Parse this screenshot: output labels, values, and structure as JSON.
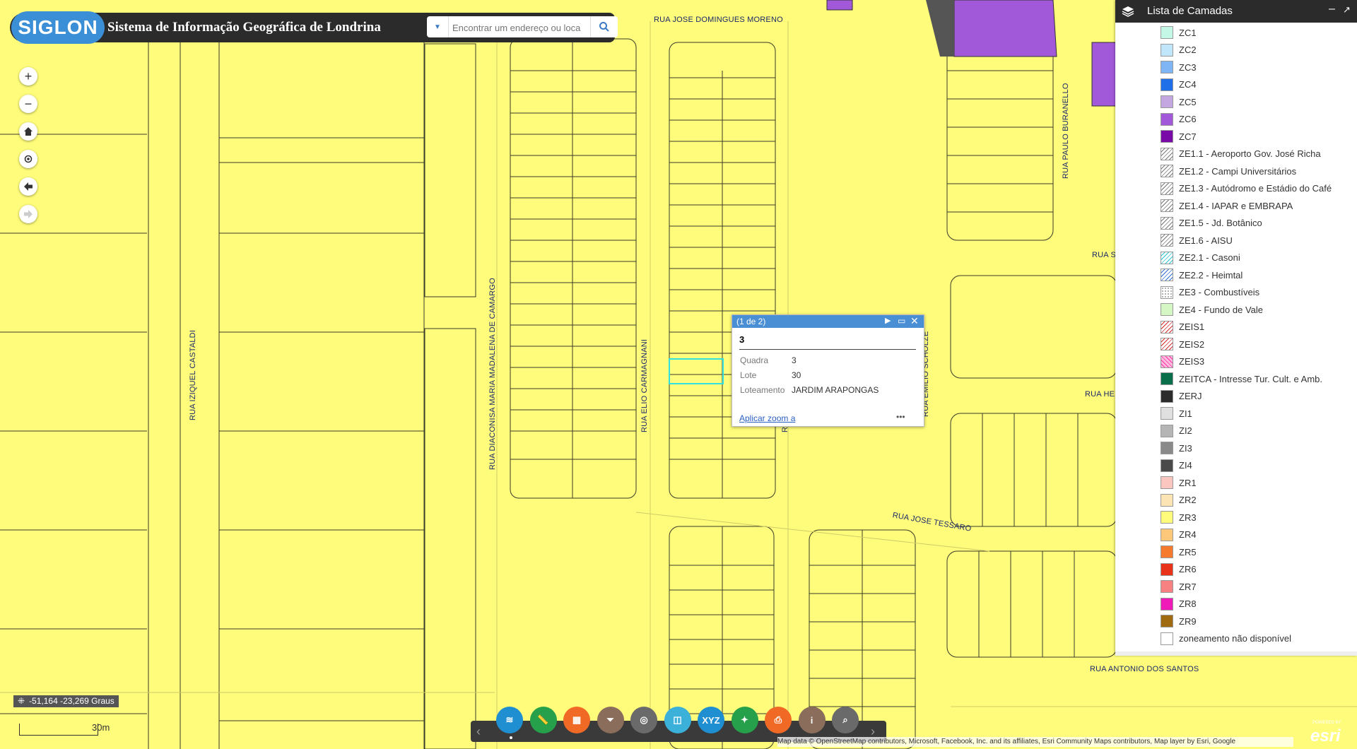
{
  "header": {
    "logo_text": "SIGLON",
    "title": "Sistema de Informação Geográfica de Londrina",
    "search_placeholder": "Encontrar um endereço ou loca"
  },
  "map_controls": {
    "zoom_in": "+",
    "zoom_out": "−"
  },
  "streets": {
    "s1": "RUA JOSE DOMINGUES MORENO",
    "s2": "RUA IZIQUEL CASTALDI",
    "s3": "RUA DIACONISA MARIA MADALENA DE CAMARGO",
    "s4": "RUA ELIO CARMAGNANI",
    "s5": "RUA EMILIO SCHOLZE",
    "s6": "RUA PAULO BURANELLO",
    "s7": "RUA JOSE TESSARO",
    "s8": "RUA ANTONIO DOS SANTOS",
    "s9": "RUA S",
    "s10": "RUA HE",
    "s11": "RU"
  },
  "layer_panel": {
    "title": "Lista de Camadas",
    "items": [
      {
        "label": "ZC1",
        "color": "#c5f7e6"
      },
      {
        "label": "ZC2",
        "color": "#bfe6fb"
      },
      {
        "label": "ZC3",
        "color": "#7fb5f5"
      },
      {
        "label": "ZC4",
        "color": "#1e6fe8"
      },
      {
        "label": "ZC5",
        "color": "#c4a6e0"
      },
      {
        "label": "ZC6",
        "color": "#a259d9"
      },
      {
        "label": "ZC7",
        "color": "#7a0aa8"
      },
      {
        "label": "ZE1.1 - Aeroporto Gov. José Richa",
        "color": "hatch-gray"
      },
      {
        "label": "ZE1.2 - Campi Universitários",
        "color": "hatch-gray"
      },
      {
        "label": "ZE1.3 - Autódromo e Estádio do Café",
        "color": "hatch-gray"
      },
      {
        "label": "ZE1.4 - IAPAR e EMBRAPA",
        "color": "hatch-gray"
      },
      {
        "label": "ZE1.5 - Jd. Botânico",
        "color": "hatch-gray"
      },
      {
        "label": "ZE1.6 - AISU",
        "color": "hatch-gray"
      },
      {
        "label": "ZE2.1 - Casoni",
        "color": "hatch-cyan"
      },
      {
        "label": "ZE2.2 - Heimtal",
        "color": "hatch-blue"
      },
      {
        "label": "ZE3 - Combustíveis",
        "color": "dots"
      },
      {
        "label": "ZE4 - Fundo de Vale",
        "color": "#d4f7c4"
      },
      {
        "label": "ZEIS1",
        "color": "hatch-red"
      },
      {
        "label": "ZEIS2",
        "color": "hatch-red"
      },
      {
        "label": "ZEIS3",
        "color": "cross-red"
      },
      {
        "label": "ZEITCA - Intresse Tur. Cult. e Amb.",
        "color": "#0b6e4a"
      },
      {
        "label": "ZERJ",
        "color": "#2b2b2b"
      },
      {
        "label": "ZI1",
        "color": "#e0e0e0"
      },
      {
        "label": "ZI2",
        "color": "#b5b5b5"
      },
      {
        "label": "ZI3",
        "color": "#8a8a8a"
      },
      {
        "label": "ZI4",
        "color": "#4a4a4a"
      },
      {
        "label": "ZR1",
        "color": "#fbc6c0"
      },
      {
        "label": "ZR2",
        "color": "#fde4b4"
      },
      {
        "label": "ZR3",
        "color": "#fefc7a"
      },
      {
        "label": "ZR4",
        "color": "#fdc87a"
      },
      {
        "label": "ZR5",
        "color": "#f67a2e"
      },
      {
        "label": "ZR6",
        "color": "#e8331a"
      },
      {
        "label": "ZR7",
        "color": "#f78080"
      },
      {
        "label": "ZR8",
        "color": "#f01ab8"
      },
      {
        "label": "ZR9",
        "color": "#a06a10"
      },
      {
        "label": "zoneamento não disponível",
        "color": "#ffffff"
      }
    ]
  },
  "popup": {
    "counter": "(1 de 2)",
    "title": "3",
    "fields": [
      {
        "label": "Quadra",
        "value": "3"
      },
      {
        "label": "Lote",
        "value": "30"
      },
      {
        "label": "Loteamento",
        "value": "JARDIM ARAPONGAS"
      }
    ],
    "zoom_link": "Aplicar zoom a",
    "more": "•••"
  },
  "toolbar": {
    "tools": [
      {
        "name": "layers",
        "color": "#1f8fd1",
        "glyph": "≋"
      },
      {
        "name": "measure",
        "color": "#26a04a",
        "glyph": "📏"
      },
      {
        "name": "basemap",
        "color": "#f06a26",
        "glyph": "▦"
      },
      {
        "name": "filter",
        "color": "#8a6d5a",
        "glyph": "⏷"
      },
      {
        "name": "locate",
        "color": "#6a6a6a",
        "glyph": "◎"
      },
      {
        "name": "swipe",
        "color": "#3bb0d8",
        "glyph": "◫"
      },
      {
        "name": "coordinates",
        "color": "#1f8fd1",
        "glyph": "XYZ"
      },
      {
        "name": "share",
        "color": "#26a04a",
        "glyph": "✦"
      },
      {
        "name": "print",
        "color": "#f06a26",
        "glyph": "⎙"
      },
      {
        "name": "about",
        "color": "#8a6d5a",
        "glyph": "i"
      },
      {
        "name": "query",
        "color": "#6a6a6a",
        "glyph": "⌕"
      }
    ],
    "prev": "‹",
    "next": "›"
  },
  "coords": "-51,164 -23,269 Graus",
  "scale_label": "30m",
  "attribution": "Map data © OpenStreetMap contributors, Microsoft, Facebook, Inc. and its affiliates, Esri Community Maps contributors, Map layer by Esri, Google",
  "esri_logo": "esri",
  "esri_powered": "POWERED BY"
}
